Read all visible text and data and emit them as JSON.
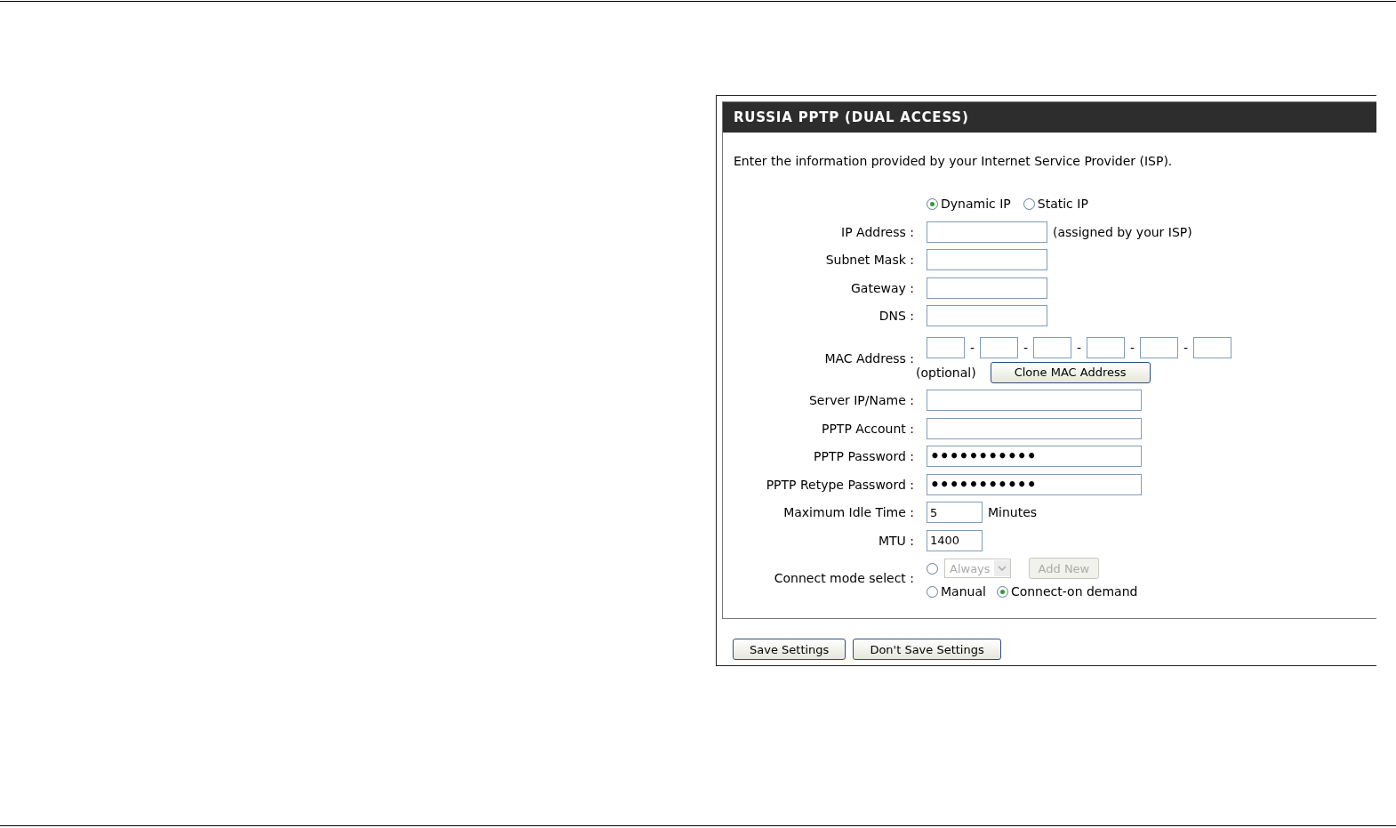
{
  "section": {
    "title": "RUSSIA PPTP (DUAL ACCESS)",
    "intro": "Enter the information provided by your Internet Service Provider (ISP).",
    "address_mode": [
      {
        "label": "Dynamic IP",
        "selected": true
      },
      {
        "label": "Static IP",
        "selected": false
      }
    ],
    "fields": [
      {
        "kind": "medium",
        "label": "IP Address :",
        "note": "(assigned by your ISP)"
      },
      {
        "kind": "medium",
        "label": "Subnet Mask :"
      },
      {
        "kind": "medium",
        "label": "Gateway :"
      },
      {
        "kind": "medium",
        "label": "DNS :"
      },
      {
        "kind": "mac",
        "label": "MAC Address :",
        "separators": [
          "-",
          "-",
          "-",
          "-",
          "-"
        ],
        "note": "(optional)",
        "button": "Clone MAC Address"
      },
      {
        "kind": "long",
        "label": "Server IP/Name :"
      },
      {
        "kind": "long",
        "label": "PPTP Account :"
      },
      {
        "kind": "password",
        "label": "PPTP Password :",
        "value": "•••••••••••"
      },
      {
        "kind": "password",
        "label": "PPTP Retype Password :",
        "value": "•••••••••••"
      },
      {
        "kind": "short",
        "label": "Maximum Idle Time :",
        "value": "5",
        "note": "Minutes"
      },
      {
        "kind": "short",
        "label": "MTU :",
        "value": "1400"
      },
      {
        "kind": "connect",
        "label": "Connect mode select :",
        "options": [
          {
            "kind": "schedule",
            "selected": false,
            "disabled": true,
            "select": "Always",
            "button": "Add New"
          },
          {
            "kind": "radio",
            "label": "Manual",
            "selected": false
          },
          {
            "kind": "radio",
            "label": "Connect-on demand",
            "selected": true
          }
        ]
      }
    ]
  },
  "buttons": [
    "Save Settings",
    "Don't Save Settings"
  ]
}
